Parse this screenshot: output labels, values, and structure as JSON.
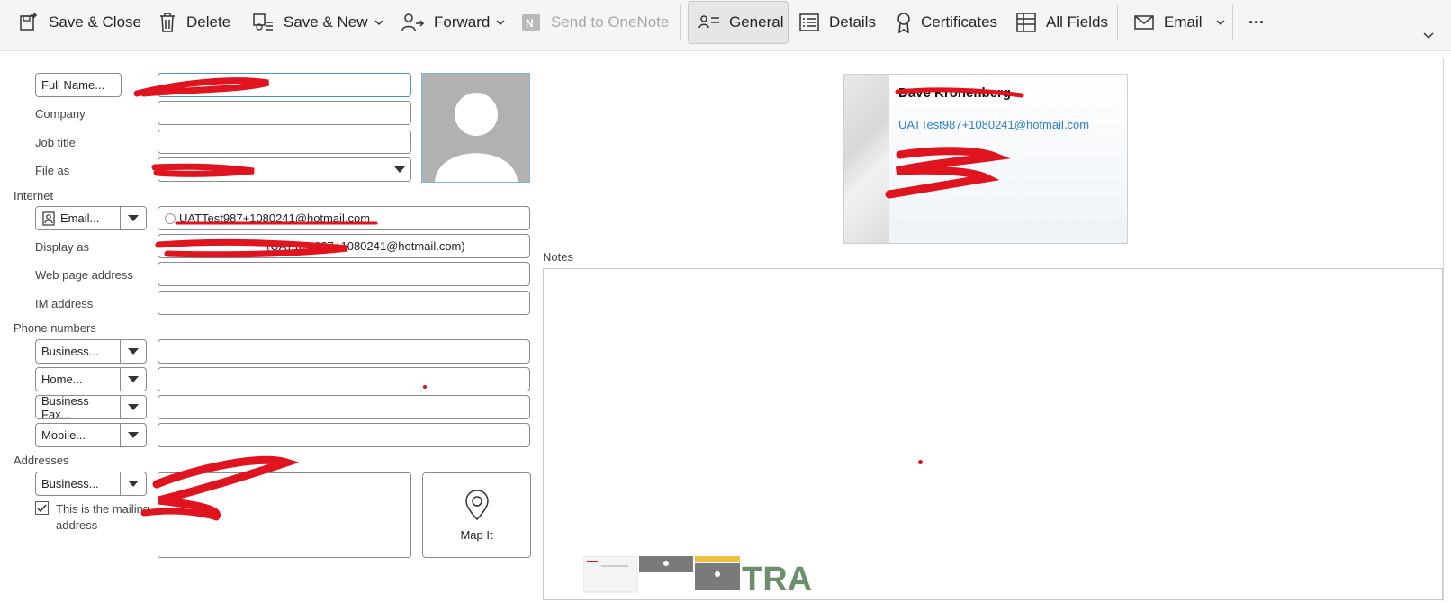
{
  "ribbon": {
    "save_close": "Save & Close",
    "delete": "Delete",
    "save_new": "Save & New",
    "forward": "Forward",
    "send_onenote": "Send to OneNote",
    "general": "General",
    "details": "Details",
    "certificates": "Certificates",
    "all_fields": "All Fields",
    "email": "Email",
    "more": "···"
  },
  "form": {
    "full_name_button": "Full Name...",
    "company_label": "Company",
    "job_title_label": "Job title",
    "file_as_label": "File as",
    "internet_section": "Internet",
    "email_button": "Email...",
    "email_value": "UATTest987+1080241@hotmail.com",
    "display_as_label": "Display as",
    "display_as_value": "(UATTest987+1080241@hotmail.com)",
    "web_page_label": "Web page address",
    "im_label": "IM address",
    "phone_section": "Phone numbers",
    "phones": [
      "Business...",
      "Home...",
      "Business Fax...",
      "Mobile..."
    ],
    "addresses_section": "Addresses",
    "address_type": "Business...",
    "mailing_address_label": "This is the mailing address",
    "map_it": "Map It",
    "notes_label": "Notes"
  },
  "card": {
    "name": "Dave Kronenberg",
    "email": "UATTest987+1080241@hotmail.com"
  },
  "colors": {
    "accent": "#2b7cd3",
    "redaction": "#e0141e",
    "photo_bg": "#b1b1b1"
  }
}
